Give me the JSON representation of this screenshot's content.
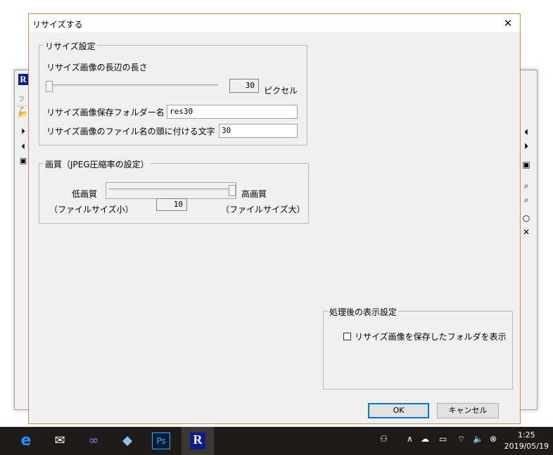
{
  "dialog": {
    "title": "リサイズする",
    "close_glyph": "✕"
  },
  "resize_group": {
    "legend": "リサイズ設定",
    "length_label": "リサイズ画像の長辺の長さ",
    "length_value": "30",
    "length_unit": "ピクセル",
    "length_slider_level": 0.02,
    "folder_label": "リサイズ画像保存フォルダー名",
    "folder_value": "res30",
    "prefix_label": "リサイズ画像のファイル名の頭に付ける文字",
    "prefix_value": "30"
  },
  "quality_group": {
    "legend": "画質（JPEG圧縮率の設定）",
    "low_label": "低画質",
    "high_label": "高画質",
    "small_label": "（ファイルサイズ小）",
    "large_label": "（ファイルサイズ大）",
    "quality_value": "10",
    "quality_slider_level": 1.0
  },
  "display_group": {
    "legend": "処理後の表示設定",
    "show_folder_label": "リサイズ画像を保存したフォルダを表示",
    "show_folder_checked": false
  },
  "buttons": {
    "ok": "OK",
    "cancel": "キャンセル"
  },
  "background_app": {
    "logo": "R",
    "menu": "ファ"
  },
  "taskbar": {
    "time": "1:25",
    "date": "2019/05/19",
    "apps": [
      "edge-icon",
      "mail-icon",
      "infinity-icon",
      "notes-icon",
      "photoshop-icon",
      "r-app-icon"
    ],
    "photoshop_label": "Ps",
    "r_label": "R"
  }
}
